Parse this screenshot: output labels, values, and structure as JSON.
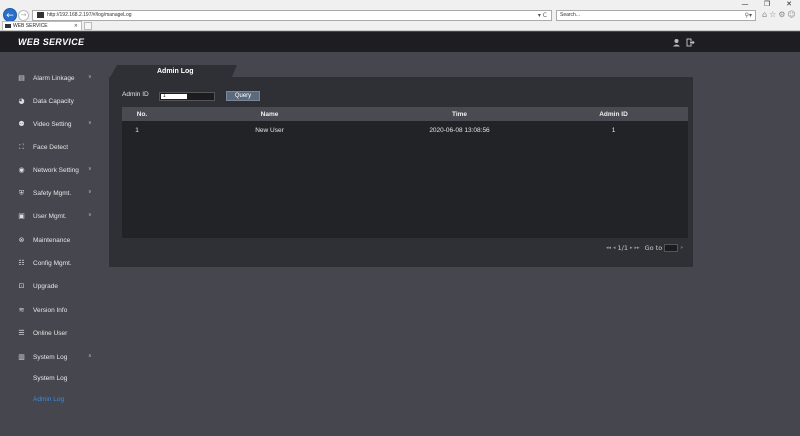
{
  "browser": {
    "url": "http://192.168.2.197/#/log/manageLog",
    "search_placeholder": "Search...",
    "tab_title": "WEB SERVICE",
    "window_controls": [
      "—",
      "❐",
      "✕"
    ],
    "address_controls": "▾ C",
    "search_icon": "⚲▾",
    "tool_icons": [
      "⌂",
      "☆",
      "⚙",
      "☺"
    ]
  },
  "header": {
    "brand": "WEB SERVICE",
    "user_icon": "user-icon",
    "logout_icon": "logout-icon"
  },
  "sidebar": {
    "items": [
      {
        "label": "Alarm Linkage",
        "icon": "alarm-icon",
        "expandable": true
      },
      {
        "label": "Data Capacity",
        "icon": "pie-chart-icon",
        "expandable": false
      },
      {
        "label": "Video Setting",
        "icon": "video-icon",
        "expandable": true
      },
      {
        "label": "Face Detect",
        "icon": "face-detect-icon",
        "expandable": false
      },
      {
        "label": "Network Setting",
        "icon": "globe-icon",
        "expandable": true
      },
      {
        "label": "Safety Mgmt.",
        "icon": "shield-icon",
        "expandable": true
      },
      {
        "label": "User Mgmt.",
        "icon": "user-card-icon",
        "expandable": true
      },
      {
        "label": "Maintenance",
        "icon": "maintenance-icon",
        "expandable": false
      },
      {
        "label": "Config Mgmt.",
        "icon": "sliders-icon",
        "expandable": false
      },
      {
        "label": "Upgrade",
        "icon": "upgrade-icon",
        "expandable": false
      },
      {
        "label": "Version Info",
        "icon": "layers-icon",
        "expandable": false
      },
      {
        "label": "Online User",
        "icon": "list-icon",
        "expandable": false
      },
      {
        "label": "System Log",
        "icon": "log-icon",
        "expandable": true,
        "expanded": true
      }
    ],
    "subitems": [
      {
        "label": "System Log",
        "active": false
      },
      {
        "label": "Admin Log",
        "active": true
      }
    ]
  },
  "main": {
    "tab_label": "Admin Log",
    "filter": {
      "label": "Admin ID",
      "value": "1",
      "query_label": "Query"
    },
    "table": {
      "columns": [
        "No.",
        "Name",
        "Time",
        "Admin ID"
      ],
      "rows": [
        [
          "1",
          "New User",
          "2020-06-08 13:08:56",
          "1"
        ]
      ]
    },
    "pager": {
      "page": "1/1",
      "goto_label": "Go to"
    }
  },
  "colors": {
    "background": "#45464e",
    "header": "#1e1e22",
    "panel": "#2f3036",
    "active": "#3a8de6"
  }
}
